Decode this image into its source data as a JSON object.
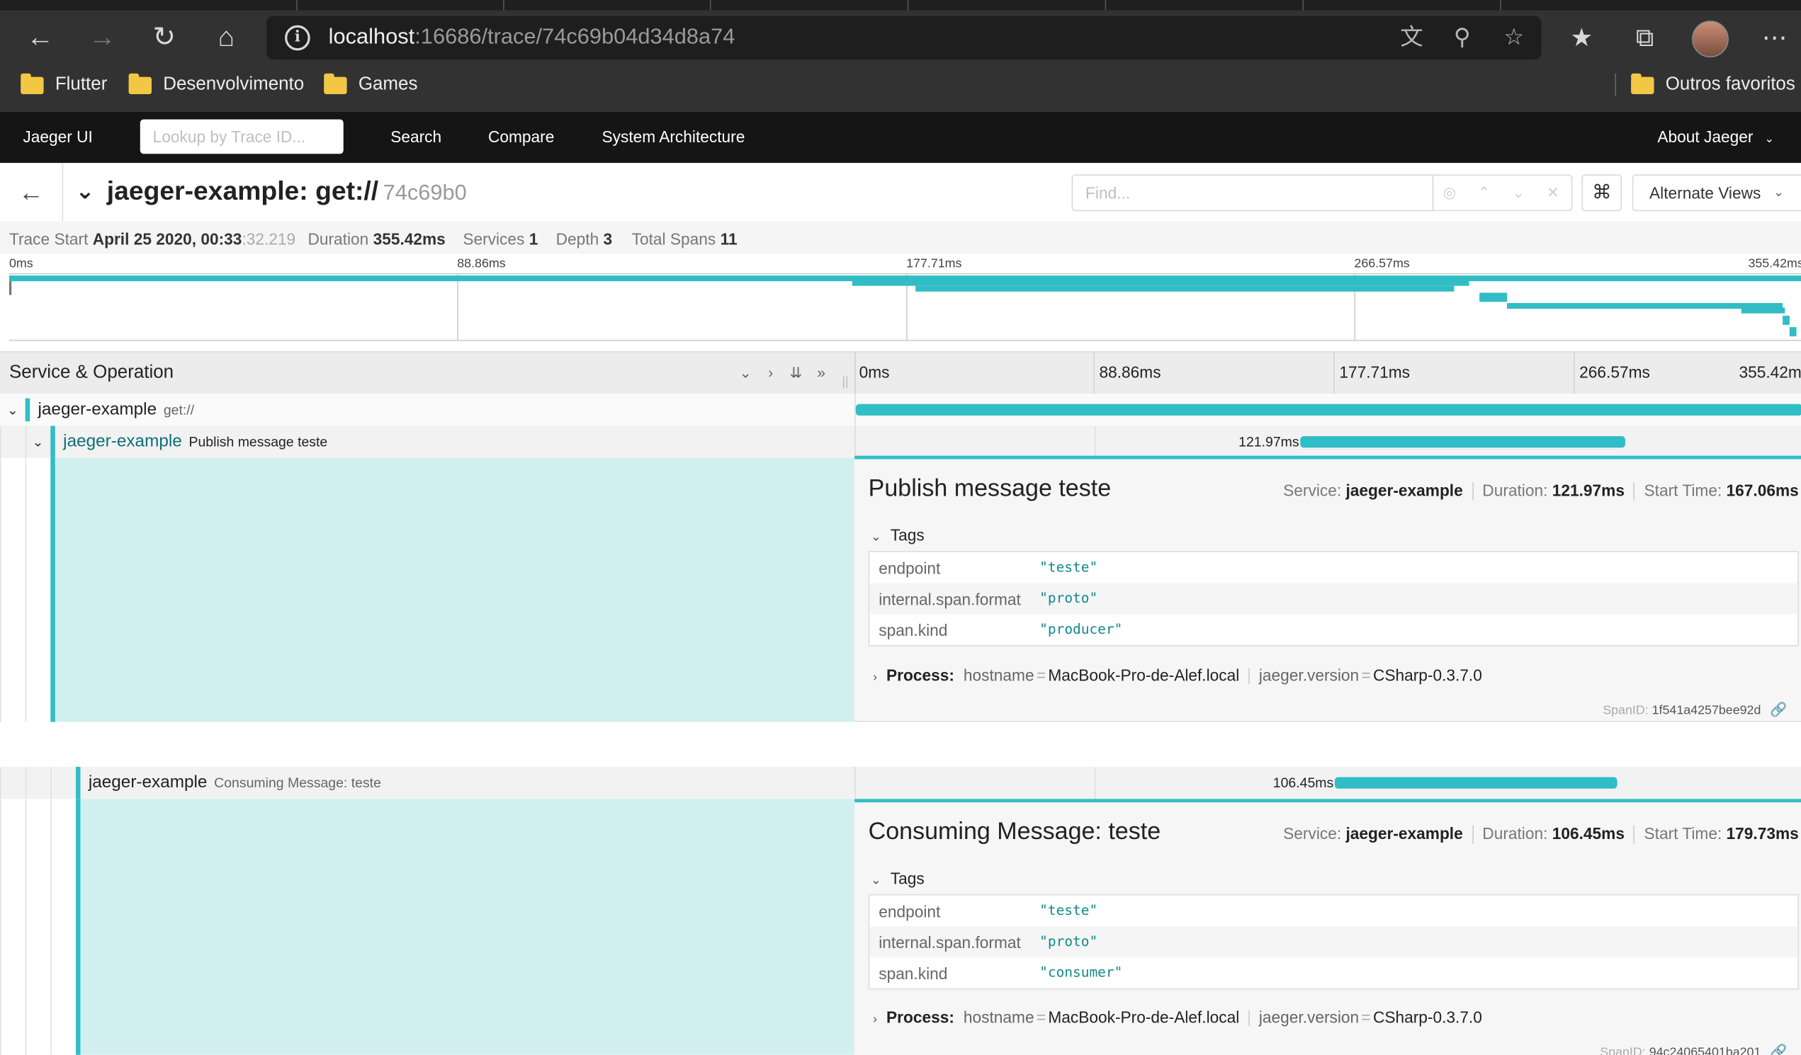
{
  "browser": {
    "url_host": "localhost",
    "url_rest": ":16686/trace/74c69b04d34d8a74",
    "bookmarks": [
      "Flutter",
      "Desenvolvimento",
      "Games"
    ],
    "other_bookmarks": "Outros favoritos"
  },
  "nav": {
    "brand": "Jaeger UI",
    "lookup_placeholder": "Lookup by Trace ID...",
    "links": [
      "Search",
      "Compare",
      "System Architecture"
    ],
    "about": "About Jaeger"
  },
  "trace": {
    "title": "jaeger-example: get://",
    "short_id": "74c69b0",
    "find_placeholder": "Find...",
    "alternate_views": "Alternate Views",
    "summary": {
      "trace_start_label": "Trace Start",
      "trace_start_value": "April 25 2020, 00:33",
      "trace_start_ms": ":32.219",
      "duration_label": "Duration",
      "duration_value": "355.42ms",
      "services_label": "Services",
      "services_value": "1",
      "depth_label": "Depth",
      "depth_value": "3",
      "total_spans_label": "Total Spans",
      "total_spans_value": "11"
    },
    "ticks": [
      "0ms",
      "88.86ms",
      "177.71ms",
      "266.57ms",
      "355.42ms"
    ]
  },
  "timeline": {
    "column_title": "Service & Operation"
  },
  "colors": {
    "accent": "#31bdc6",
    "detail_bg": "#d3f0f0",
    "nav_bg": "#151515",
    "browser_bg": "#323232"
  },
  "spans": [
    {
      "service": "jaeger-example",
      "operation": "get://",
      "start_ms": 0,
      "duration_ms": 355.42
    },
    {
      "service": "jaeger-example",
      "operation": "Publish message teste",
      "duration_label": "121.97ms",
      "start_ms": 167.06,
      "duration_ms": 121.97,
      "detail": {
        "title": "Publish message teste",
        "service_label": "Service:",
        "service": "jaeger-example",
        "duration_label": "Duration:",
        "duration": "121.97ms",
        "start_label": "Start Time:",
        "start": "167.06ms",
        "tags_label": "Tags",
        "tags": [
          {
            "key": "endpoint",
            "value": "\"teste\""
          },
          {
            "key": "internal.span.format",
            "value": "\"proto\""
          },
          {
            "key": "span.kind",
            "value": "\"producer\""
          }
        ],
        "process_label": "Process:",
        "process": [
          {
            "key": "hostname",
            "value": "MacBook-Pro-de-Alef.local"
          },
          {
            "key": "jaeger.version",
            "value": "CSharp-0.3.7.0"
          }
        ],
        "span_id_label": "SpanID:",
        "span_id": "1f541a4257bee92d"
      }
    },
    {
      "service": "jaeger-example",
      "operation": "Consuming Message: teste",
      "duration_label": "106.45ms",
      "start_ms": 179.73,
      "duration_ms": 106.45,
      "detail": {
        "title": "Consuming Message: teste",
        "service_label": "Service:",
        "service": "jaeger-example",
        "duration_label": "Duration:",
        "duration": "106.45ms",
        "start_label": "Start Time:",
        "start": "179.73ms",
        "tags_label": "Tags",
        "tags": [
          {
            "key": "endpoint",
            "value": "\"teste\""
          },
          {
            "key": "internal.span.format",
            "value": "\"proto\""
          },
          {
            "key": "span.kind",
            "value": "\"consumer\""
          }
        ],
        "process_label": "Process:",
        "process": [
          {
            "key": "hostname",
            "value": "MacBook-Pro-de-Alef.local"
          },
          {
            "key": "jaeger.version",
            "value": "CSharp-0.3.7.0"
          }
        ],
        "span_id_label": "SpanID:",
        "span_id": "94c24065401ba201"
      }
    }
  ]
}
